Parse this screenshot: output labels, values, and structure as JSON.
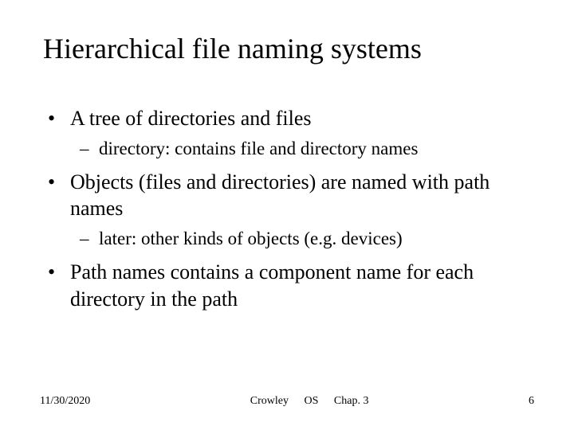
{
  "title": "Hierarchical file naming systems",
  "bullets": [
    {
      "level": 1,
      "text": "A tree of directories and files"
    },
    {
      "level": 2,
      "text": "directory: contains file and directory names"
    },
    {
      "level": 1,
      "text": "Objects (files and directories) are named with path names"
    },
    {
      "level": 2,
      "text": "later: other kinds of objects (e.g. devices)"
    },
    {
      "level": 1,
      "text": "Path names contains a component name for each directory in the path"
    }
  ],
  "footer": {
    "date": "11/30/2020",
    "author": "Crowley",
    "course": "OS",
    "chapter": "Chap. 3",
    "page": "6"
  }
}
